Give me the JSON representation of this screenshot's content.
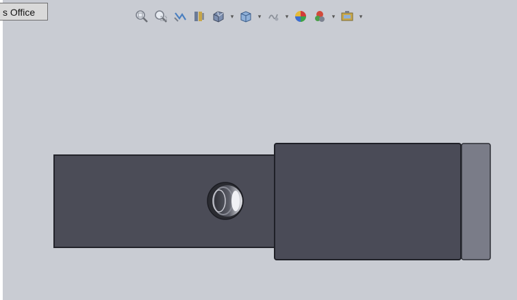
{
  "window": {
    "taskbar_tab_label": "s Office"
  },
  "toolbar": {
    "buttons": [
      {
        "icon": "zoom-to-fit-icon"
      },
      {
        "icon": "zoom-to-area-icon"
      },
      {
        "icon": "previous-view-icon"
      },
      {
        "icon": "section-view-icon"
      },
      {
        "icon": "view-orientation-icon",
        "has_dropdown": true
      },
      {
        "icon": "display-style-icon",
        "has_dropdown": true
      },
      {
        "icon": "hide-show-items-icon",
        "has_dropdown": true
      },
      {
        "icon": "edit-appearance-icon"
      },
      {
        "icon": "apply-scene-icon",
        "has_dropdown": true
      },
      {
        "icon": "view-settings-icon",
        "has_dropdown": true
      }
    ],
    "dropdown_glyph": "▾"
  },
  "colors": {
    "viewport_bg": "#c9ccd3",
    "part_face": "#4b4c57",
    "part_edge": "#22232a",
    "end_cap": "#7a7c88"
  }
}
